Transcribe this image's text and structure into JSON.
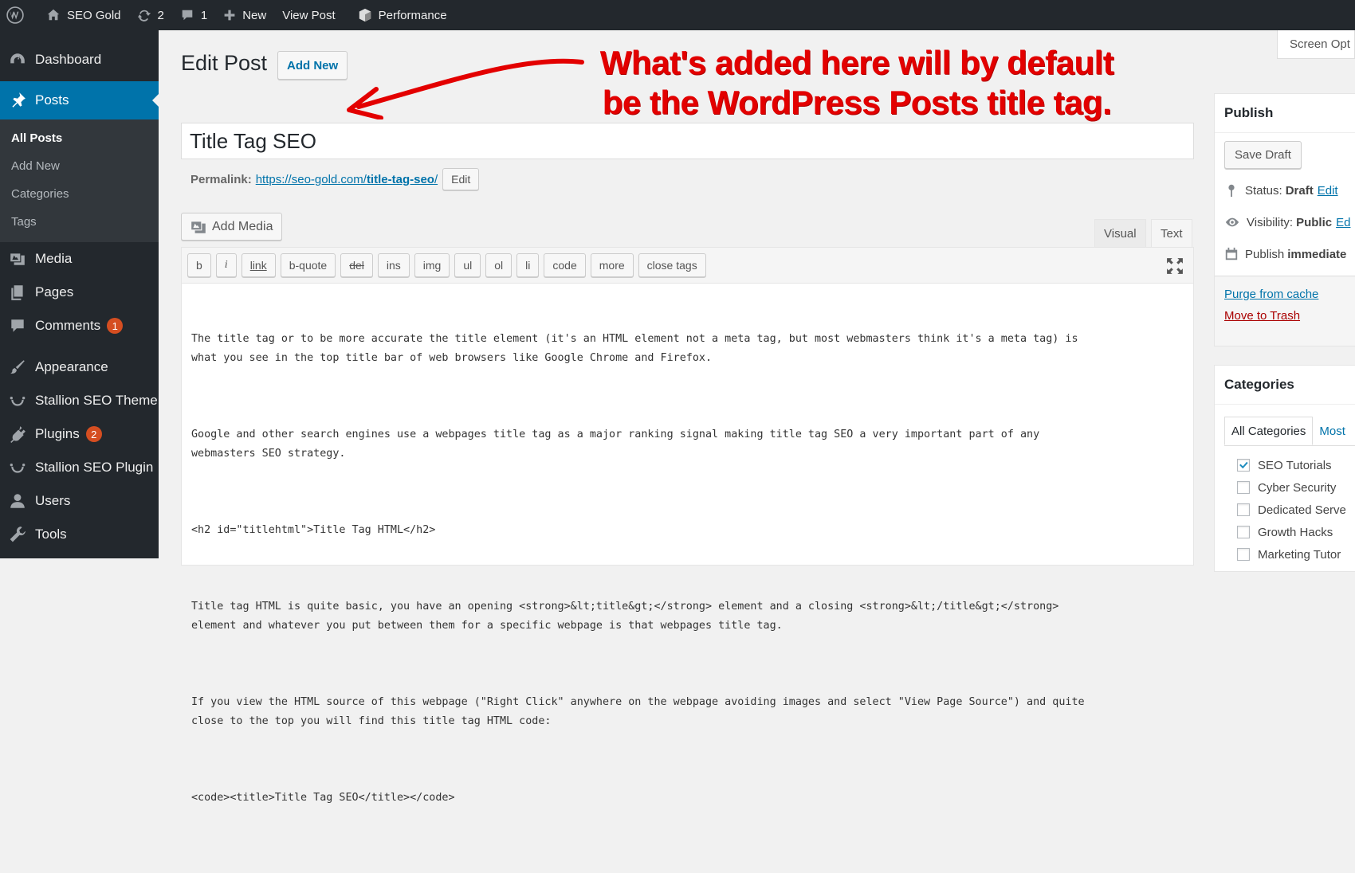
{
  "adminbar": {
    "site_name": "SEO Gold",
    "updates_count": "2",
    "comments_count": "1",
    "new_label": "New",
    "view_post_label": "View Post",
    "performance_label": "Performance"
  },
  "sidebar": {
    "items": [
      {
        "label": "Dashboard",
        "icon": "dashboard-icon"
      },
      {
        "label": "Posts",
        "icon": "pin-icon"
      },
      {
        "label": "Media",
        "icon": "media-icon"
      },
      {
        "label": "Pages",
        "icon": "pages-icon"
      },
      {
        "label": "Comments",
        "icon": "comments-icon",
        "badge": "1"
      },
      {
        "label": "Appearance",
        "icon": "brush-icon"
      },
      {
        "label": "Stallion SEO Theme",
        "icon": "smile-icon"
      },
      {
        "label": "Plugins",
        "icon": "plugin-icon",
        "badge": "2"
      },
      {
        "label": "Stallion SEO Plugin",
        "icon": "smile-icon"
      },
      {
        "label": "Users",
        "icon": "users-icon"
      },
      {
        "label": "Tools",
        "icon": "wrench-icon"
      }
    ],
    "posts_submenu": [
      "All Posts",
      "Add New",
      "Categories",
      "Tags"
    ]
  },
  "header": {
    "screen_options": "Screen Opt",
    "page_title": "Edit Post",
    "add_new": "Add New"
  },
  "post": {
    "title": "Title Tag SEO",
    "permalink_label": "Permalink:",
    "permalink_base": "https://seo-gold.com/",
    "permalink_slug": "title-tag-seo",
    "permalink_end": "/",
    "permalink_edit": "Edit"
  },
  "editor": {
    "add_media": "Add Media",
    "tab_visual": "Visual",
    "tab_text": "Text",
    "toolbar": [
      "b",
      "i",
      "link",
      "b-quote",
      "del",
      "ins",
      "img",
      "ul",
      "ol",
      "li",
      "code",
      "more",
      "close tags"
    ],
    "paragraphs": [
      "The title tag or to be more accurate the title element (it's an HTML element not a meta tag, but most webmasters think it's a meta tag) is\nwhat you see in the top title bar of web browsers like Google Chrome and Firefox.",
      "Google and other search engines use a webpages title tag as a major ranking signal making title tag SEO a very important part of any\nwebmasters SEO strategy.",
      "<h2 id=\"titlehtml\">Title Tag HTML</h2>",
      "Title tag HTML is quite basic, you have an opening <strong>&lt;title&gt;</strong> element and a closing <strong>&lt;/title&gt;</strong>\nelement and whatever you put between them for a specific webpage is that webpages title tag.",
      "If you view the HTML source of this webpage (\"Right Click\" anywhere on the webpage avoiding images and select \"View Page Source\") and quite\nclose to the top you will find this title tag HTML code:",
      "<code><title>Title Tag SEO</title></code>"
    ]
  },
  "publish": {
    "heading": "Publish",
    "save_draft": "Save Draft",
    "status_label": "Status:",
    "status_value": "Draft",
    "status_edit": "Edit",
    "visibility_label": "Visibility:",
    "visibility_value": "Public",
    "visibility_edit": "Ed",
    "publish_label": "Publish",
    "publish_value": "immediate",
    "purge": "Purge from cache",
    "trash": "Move to Trash"
  },
  "categories": {
    "heading": "Categories",
    "tab_all": "All Categories",
    "tab_most": "Most",
    "items": [
      {
        "label": "SEO Tutorials",
        "checked": true
      },
      {
        "label": "Cyber Security",
        "checked": false
      },
      {
        "label": "Dedicated Serve",
        "checked": false
      },
      {
        "label": "Growth Hacks",
        "checked": false
      },
      {
        "label": "Marketing Tutor",
        "checked": false
      }
    ]
  },
  "annotation": {
    "line1": "What's added here will by default",
    "line2": "be the WordPress Posts title tag."
  },
  "colors": {
    "adminbar_bg": "#23282d",
    "active_menu": "#0073aa",
    "badge": "#d54e21",
    "annotation": "#e30000",
    "link": "#0073aa"
  }
}
